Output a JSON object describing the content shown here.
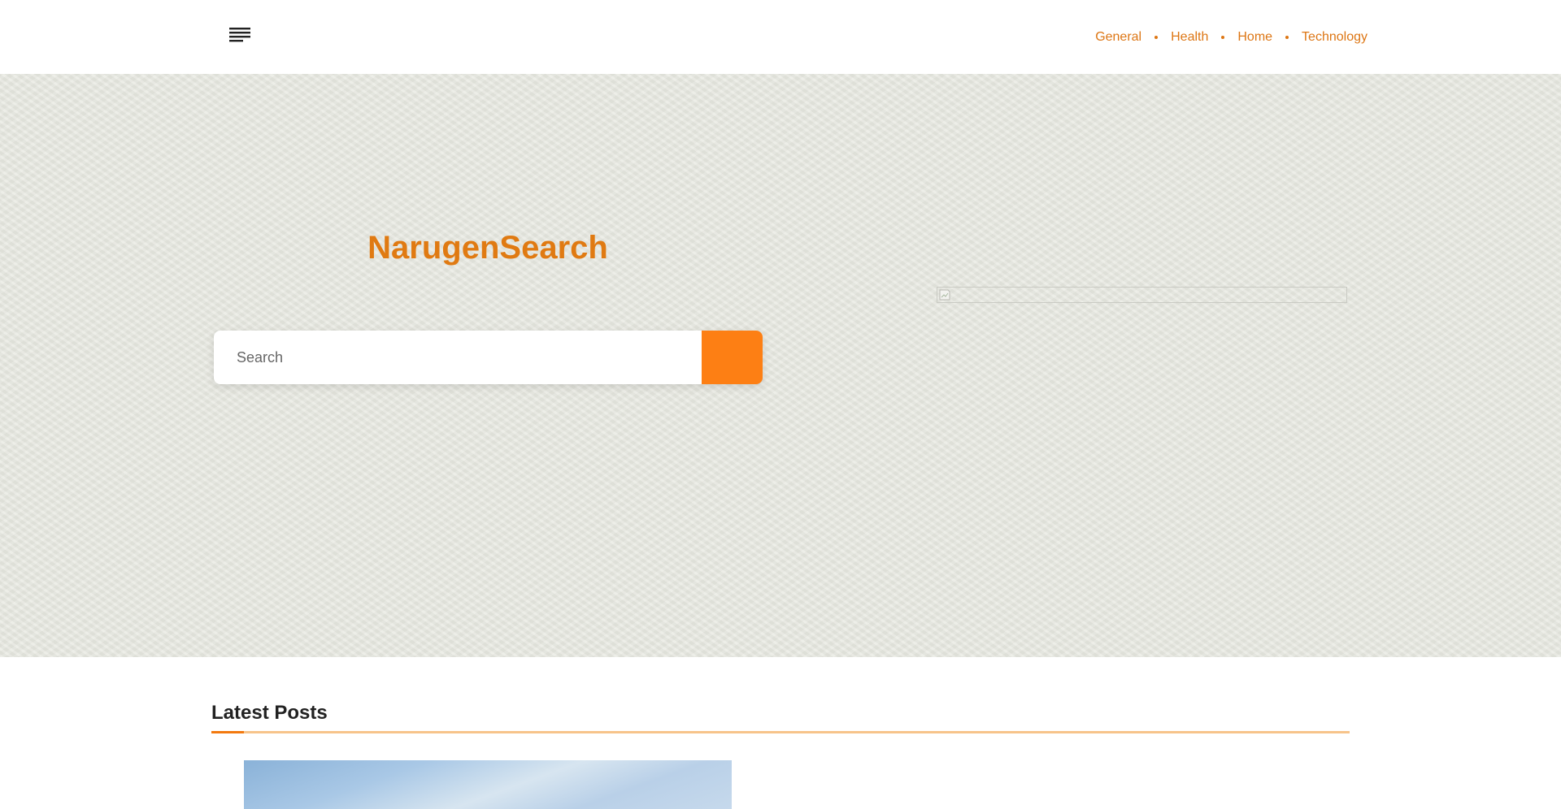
{
  "header": {
    "menu_icon": "hamburger-menu-icon",
    "nav": [
      {
        "label": "General"
      },
      {
        "label": "Health"
      },
      {
        "label": "Home"
      },
      {
        "label": "Technology"
      }
    ]
  },
  "hero": {
    "brand": "NarugenSearch",
    "search": {
      "placeholder": "Search",
      "value": "",
      "button_icon": "search-icon"
    },
    "image_icon": "broken-image-icon"
  },
  "latest_posts": {
    "title": "Latest Posts"
  },
  "colors": {
    "accent": "#dd7614",
    "button": "#fd7f14",
    "hero_bg": "#e6e7df",
    "rule": "#f7c48a"
  }
}
